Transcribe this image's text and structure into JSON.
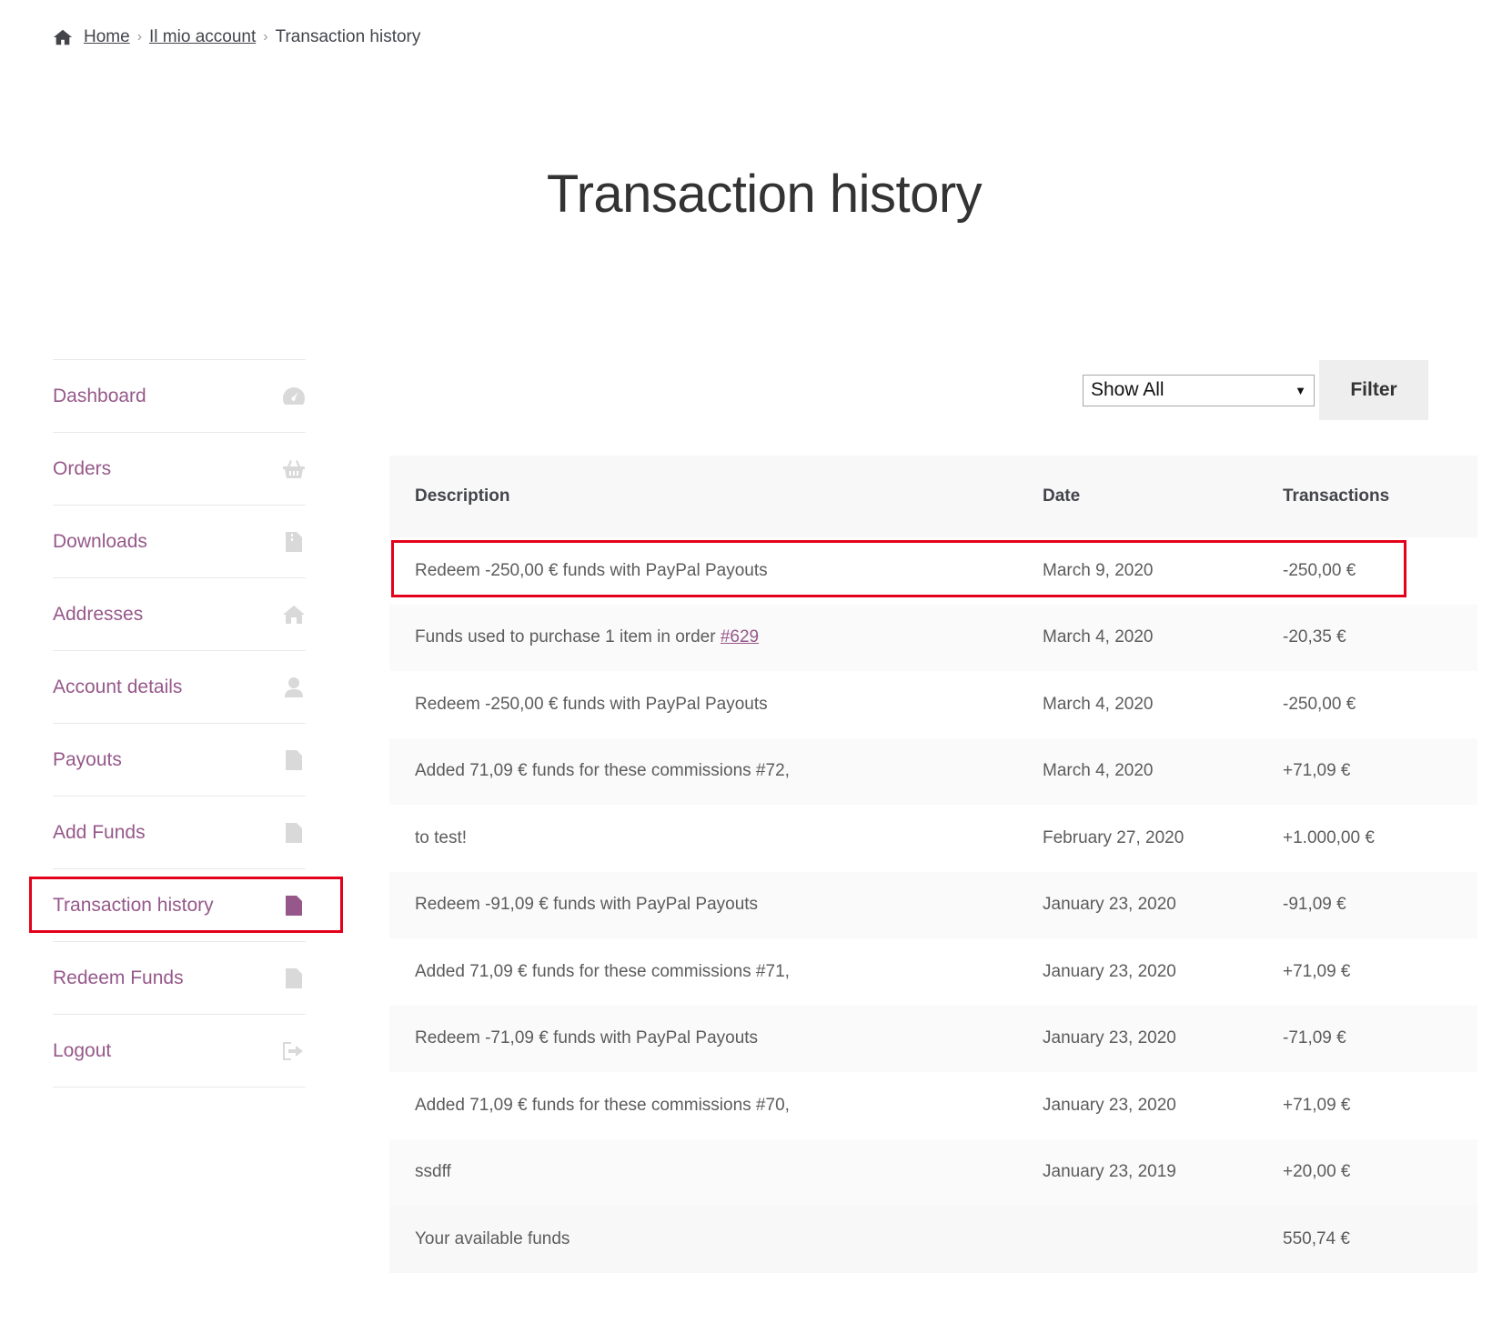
{
  "breadcrumb": {
    "home": "Home",
    "account": "Il mio account",
    "current": "Transaction history",
    "separator": "›"
  },
  "page_title": "Transaction history",
  "sidebar": {
    "items": [
      {
        "label": "Dashboard",
        "icon": "dashboard-icon"
      },
      {
        "label": "Orders",
        "icon": "basket-icon"
      },
      {
        "label": "Downloads",
        "icon": "file-icon"
      },
      {
        "label": "Addresses",
        "icon": "home-icon"
      },
      {
        "label": "Account details",
        "icon": "user-icon"
      },
      {
        "label": "Payouts",
        "icon": "document-icon"
      },
      {
        "label": "Add Funds",
        "icon": "document-icon"
      },
      {
        "label": "Transaction history",
        "icon": "document-icon",
        "active": true
      },
      {
        "label": "Redeem Funds",
        "icon": "document-icon"
      },
      {
        "label": "Logout",
        "icon": "logout-icon"
      }
    ]
  },
  "filter": {
    "selected": "Show All",
    "button_label": "Filter"
  },
  "table": {
    "headers": [
      "Description",
      "Date",
      "Transactions"
    ],
    "rows": [
      {
        "description": "Redeem -250,00 € funds with PayPal Payouts",
        "date": "March 9, 2020",
        "amount": "-250,00 €"
      },
      {
        "description": "Funds used to purchase 1 item in order ",
        "link": "#629",
        "date": "March 4, 2020",
        "amount": "-20,35 €"
      },
      {
        "description": "Redeem -250,00 € funds with PayPal Payouts",
        "date": "March 4, 2020",
        "amount": "-250,00 €"
      },
      {
        "description": "Added 71,09 € funds for these commissions #72,",
        "date": "March 4, 2020",
        "amount": "+71,09 €"
      },
      {
        "description": "to test!",
        "date": "February 27, 2020",
        "amount": "+1.000,00 €"
      },
      {
        "description": "Redeem -91,09 € funds with PayPal Payouts",
        "date": "January 23, 2020",
        "amount": "-91,09 €"
      },
      {
        "description": "Added 71,09 € funds for these commissions #71,",
        "date": "January 23, 2020",
        "amount": "+71,09 €"
      },
      {
        "description": "Redeem -71,09 € funds with PayPal Payouts",
        "date": "January 23, 2020",
        "amount": "-71,09 €"
      },
      {
        "description": "Added 71,09 € funds for these commissions #70,",
        "date": "January 23, 2020",
        "amount": "+71,09 €"
      },
      {
        "description": "ssdff",
        "date": "January 23, 2019",
        "amount": "+20,00 €"
      }
    ],
    "total": {
      "label": "Your available funds",
      "amount": "550,74 €"
    }
  },
  "colors": {
    "accent": "#96588a",
    "highlight": "#e3001b",
    "icon_muted": "#d9d9d9"
  }
}
